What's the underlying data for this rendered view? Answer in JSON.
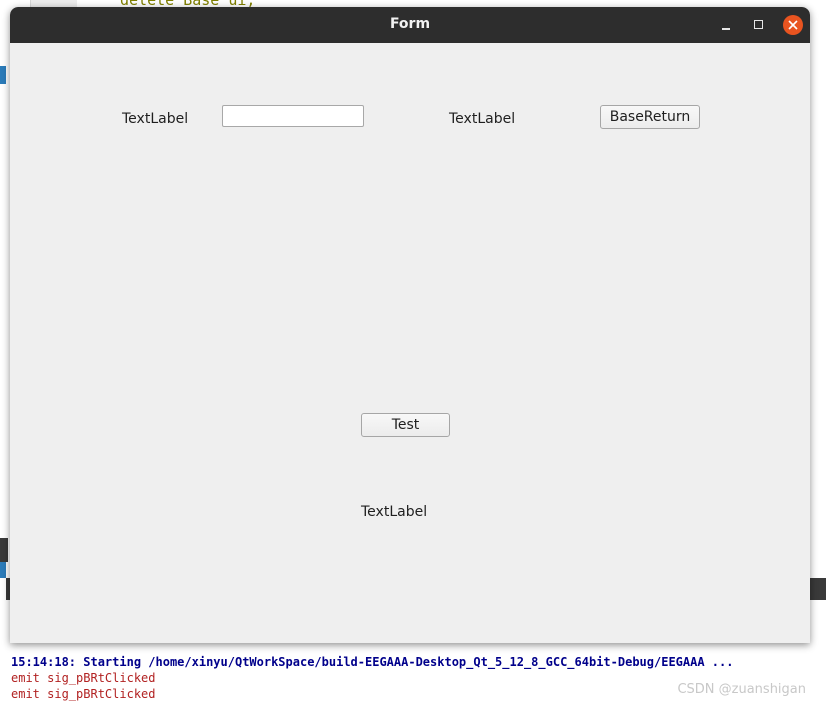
{
  "background_editor": {
    "code_fragment": "delete Base ui;"
  },
  "window": {
    "title": "Form",
    "controls": {
      "minimize": "minimize-icon",
      "maximize": "maximize-icon",
      "close": "close-icon"
    },
    "close_color": "#e95420"
  },
  "form": {
    "label_top_left": "TextLabel",
    "line_edit_value": "",
    "label_top_right": "TextLabel",
    "base_return_button": "BaseReturn",
    "test_button": "Test",
    "label_bottom": "TextLabel"
  },
  "console": {
    "lines": [
      "15:14:18: Starting /home/xinyu/QtWorkSpace/build-EEGAAA-Desktop_Qt_5_12_8_GCC_64bit-Debug/EEGAAA ...",
      "emit sig_pBRtClicked",
      "emit sig_pBRtClicked"
    ]
  },
  "watermark": "CSDN @zuanshigan"
}
